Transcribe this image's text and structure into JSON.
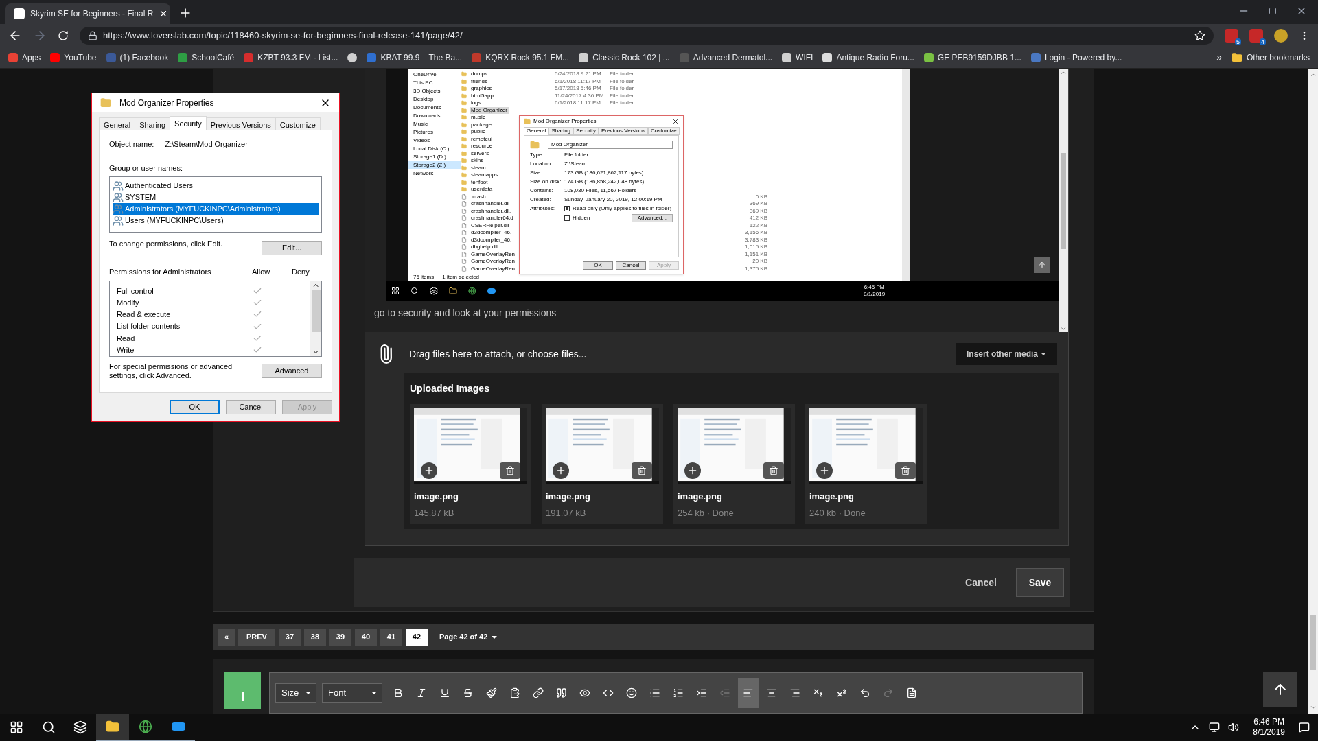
{
  "browser": {
    "tab_title": "Skyrim SE for Beginners - Final R",
    "url": "https://www.loverslab.com/topic/118460-skyrim-se-for-beginners-final-release-141/page/42/",
    "extension_badges": [
      "5",
      "4"
    ],
    "bookmarks": [
      {
        "label": "Apps",
        "color": "#e94235"
      },
      {
        "label": "YouTube",
        "color": "#ff0000"
      },
      {
        "label": "(1) Facebook",
        "color": "#3b5998"
      },
      {
        "label": "SchoolCafé",
        "color": "#2e9e44"
      },
      {
        "label": "KZBT 93.3 FM - List...",
        "color": "#d62d2d"
      },
      {
        "color": "#d0d0d0"
      },
      {
        "label": "KBAT 99.9 – The Ba...",
        "color": "#2f6fd0"
      },
      {
        "label": "KQRX Rock 95.1 FM...",
        "color": "#c0392b"
      },
      {
        "label": "Classic Rock 102 | ...",
        "color": "#d0d0d0"
      },
      {
        "label": "Advanced Dermatol...",
        "color": "#555555"
      },
      {
        "label": "WIFI",
        "color": "#d0d0d0"
      },
      {
        "label": "Antique Radio Foru...",
        "color": "#dddddd"
      },
      {
        "label": "GE PEB9159DJBB 1...",
        "color": "#7ac143"
      },
      {
        "label": "Login - Powered by...",
        "color": "#4a78c2"
      }
    ],
    "more": "»",
    "other_bookmarks": "Other bookmarks"
  },
  "post": {
    "embedded_screenshot": {
      "sidebar": [
        {
          "label": "OneDrive",
          "selected": false
        },
        {
          "label": "This PC",
          "selected": false
        },
        {
          "label": "3D Objects",
          "selected": false
        },
        {
          "label": "Desktop",
          "selected": false
        },
        {
          "label": "Documents",
          "selected": false
        },
        {
          "label": "Downloads",
          "selected": false
        },
        {
          "label": "Music",
          "selected": false
        },
        {
          "label": "Pictures",
          "selected": false
        },
        {
          "label": "Videos",
          "selected": false
        },
        {
          "label": "Local Disk (C:)",
          "selected": false
        },
        {
          "label": "Storage1 (D:)",
          "selected": false
        },
        {
          "label": "Storage2 (Z:)",
          "selected": true
        },
        {
          "label": "Network",
          "selected": false
        }
      ],
      "files": [
        {
          "kind": "folder",
          "name": "dumps",
          "date": "5/24/2018 9:21 PM",
          "type": "File folder",
          "selected": false
        },
        {
          "kind": "folder",
          "name": "friends",
          "date": "6/1/2018 11:17 PM",
          "type": "File folder",
          "selected": false
        },
        {
          "kind": "folder",
          "name": "graphics",
          "date": "5/17/2018 5:46 PM",
          "type": "File folder",
          "selected": false
        },
        {
          "kind": "folder",
          "name": "html5app",
          "date": "11/24/2017 4:36 PM",
          "type": "File folder",
          "selected": false
        },
        {
          "kind": "folder",
          "name": "logs",
          "date": "6/1/2018 11:17 PM",
          "type": "File folder",
          "selected": false
        },
        {
          "kind": "folder",
          "name": "Mod Organizer",
          "selected": true
        },
        {
          "kind": "folder",
          "name": "music",
          "selected": false
        },
        {
          "kind": "folder",
          "name": "package",
          "selected": false
        },
        {
          "kind": "folder",
          "name": "public",
          "selected": false
        },
        {
          "kind": "folder",
          "name": "remoteui",
          "selected": false
        },
        {
          "kind": "folder",
          "name": "resource",
          "selected": false
        },
        {
          "kind": "folder",
          "name": "servers",
          "selected": false
        },
        {
          "kind": "folder",
          "name": "skins",
          "selected": false
        },
        {
          "kind": "folder",
          "name": "steam",
          "selected": false
        },
        {
          "kind": "folder",
          "name": "steamapps",
          "selected": false
        },
        {
          "kind": "folder",
          "name": "tenfoot",
          "selected": false
        },
        {
          "kind": "folder",
          "name": "userdata",
          "selected": false
        },
        {
          "kind": "file",
          "name": ".crash",
          "size": "0 KB",
          "selected": false
        },
        {
          "kind": "file",
          "name": "crashhandler.dll",
          "size": "369 KB",
          "selected": false
        },
        {
          "kind": "file",
          "name": "crashhandler.dll.",
          "size": "369 KB",
          "selected": false
        },
        {
          "kind": "file",
          "name": "crashhandler64.d",
          "size": "412 KB",
          "selected": false
        },
        {
          "kind": "file",
          "name": "CSERHelper.dll",
          "size": "122 KB",
          "selected": false
        },
        {
          "kind": "file",
          "name": "d3dcompiler_46.",
          "size": "3,156 KB",
          "selected": false
        },
        {
          "kind": "file",
          "name": "d3dcompiler_46.",
          "size": "3,783 KB",
          "selected": false
        },
        {
          "kind": "file",
          "name": "dbghelp.dll",
          "size": "1,015 KB",
          "selected": false
        },
        {
          "kind": "file",
          "name": "GameOverlayRen",
          "size": "1,151 KB",
          "selected": false
        },
        {
          "kind": "file",
          "name": "GameOverlayRen",
          "size": "20 KB",
          "selected": false
        },
        {
          "kind": "file",
          "name": "GameOverlayRen",
          "size": "1,375 KB",
          "selected": false
        }
      ],
      "status": [
        "76 items",
        "1 item selected"
      ],
      "dialog": {
        "title": "Mod Organizer Properties",
        "tabs": [
          {
            "label": "General",
            "selected": true
          },
          {
            "label": "Sharing",
            "selected": false
          },
          {
            "label": "Security",
            "selected": false
          },
          {
            "label": "Previous Versions",
            "selected": false
          },
          {
            "label": "Customize",
            "selected": false
          }
        ],
        "name_value": "Mod Organizer",
        "rows": [
          {
            "label": "Type:",
            "value": "File folder"
          },
          {
            "label": "Location:",
            "value": "Z:\\Steam"
          },
          {
            "label": "Size:",
            "value": "173 GB (186,621,862,117 bytes)"
          },
          {
            "label": "Size on disk:",
            "value": "174 GB (186,858,242,048 bytes)"
          },
          {
            "label": "Contains:",
            "value": "108,030 Files, 11,567 Folders"
          },
          {
            "label": "Created:",
            "value": "Sunday, January 20, 2019, 12:00:19 PM"
          }
        ],
        "attributes_label": "Attributes:",
        "attributes": [
          {
            "label": "Read-only (Only applies to files in folder)",
            "checked": true
          },
          {
            "label": "Hidden",
            "checked": false
          }
        ],
        "advanced_button": "Advanced...",
        "buttons": [
          {
            "label": "OK",
            "disabled": false
          },
          {
            "label": "Cancel",
            "disabled": false
          },
          {
            "label": "Apply",
            "disabled": true
          }
        ]
      },
      "clock": [
        "6:45 PM",
        "8/1/2019"
      ]
    },
    "text": "go to security and look at your permissions"
  },
  "attach": {
    "hint": "Drag files here to attach, or choose files...",
    "insert_button": "Insert other media",
    "uploaded_title": "Uploaded Images",
    "images": [
      {
        "name": "image.png",
        "info": "145.87 kB"
      },
      {
        "name": "image.png",
        "info": "191.07 kB"
      },
      {
        "name": "image.png",
        "info": "254 kb · Done"
      },
      {
        "name": "image.png",
        "info": "240 kb · Done"
      }
    ]
  },
  "actions": {
    "cancel": "Cancel",
    "save": "Save"
  },
  "pagination": {
    "first": "«",
    "prev": "PREV",
    "pages": [
      {
        "label": "37",
        "selected": false
      },
      {
        "label": "38",
        "selected": false
      },
      {
        "label": "39",
        "selected": false
      },
      {
        "label": "40",
        "selected": false
      },
      {
        "label": "41",
        "selected": false
      },
      {
        "label": "42",
        "selected": true
      }
    ],
    "summary": "Page 42 of 42"
  },
  "editor": {
    "dropdowns": [
      "Size",
      "Font"
    ],
    "buttons": [
      {
        "kind": "bold",
        "selected": false,
        "disabled": false
      },
      {
        "kind": "italic",
        "selected": false,
        "disabled": false
      },
      {
        "kind": "underline",
        "selected": false,
        "disabled": false
      },
      {
        "kind": "strike",
        "selected": false,
        "disabled": false
      },
      {
        "kind": "brush",
        "selected": false,
        "disabled": false
      },
      {
        "kind": "paste",
        "selected": false,
        "disabled": false
      },
      {
        "kind": "link",
        "selected": false,
        "disabled": false
      },
      {
        "kind": "quote",
        "selected": false,
        "disabled": false
      },
      {
        "kind": "spoiler",
        "selected": false,
        "disabled": false
      },
      {
        "kind": "code",
        "selected": false,
        "disabled": false
      },
      {
        "kind": "emoji",
        "selected": false,
        "disabled": false
      },
      {
        "kind": "bullets",
        "selected": false,
        "disabled": false
      },
      {
        "kind": "numbers",
        "selected": false,
        "disabled": false
      },
      {
        "kind": "indent",
        "selected": false,
        "disabled": false
      },
      {
        "kind": "outdent",
        "selected": false,
        "disabled": true
      },
      {
        "kind": "left",
        "selected": true,
        "disabled": false
      },
      {
        "kind": "center",
        "selected": false,
        "disabled": false
      },
      {
        "kind": "right",
        "selected": false,
        "disabled": false
      },
      {
        "kind": "sub",
        "selected": false,
        "disabled": false
      },
      {
        "kind": "sup",
        "selected": false,
        "disabled": false
      },
      {
        "kind": "undo",
        "selected": false,
        "disabled": false
      },
      {
        "kind": "redo",
        "selected": false,
        "disabled": true
      },
      {
        "kind": "source",
        "selected": false,
        "disabled": false
      }
    ]
  },
  "dialog": {
    "title": "Mod Organizer Properties",
    "tabs": [
      {
        "label": "General",
        "selected": false
      },
      {
        "label": "Sharing",
        "selected": false
      },
      {
        "label": "Security",
        "selected": true
      },
      {
        "label": "Previous Versions",
        "selected": false
      },
      {
        "label": "Customize",
        "selected": false
      }
    ],
    "object_label": "Object name:",
    "object_value": "Z:\\Steam\\Mod Organizer",
    "group_label": "Group or user names:",
    "users": [
      {
        "name": "Authenticated Users",
        "selected": false
      },
      {
        "name": "SYSTEM",
        "selected": false
      },
      {
        "name": "Administrators (MYFUCKINPC\\Administrators)",
        "selected": true
      },
      {
        "name": "Users (MYFUCKINPC\\Users)",
        "selected": false
      }
    ],
    "change_hint": "To change permissions, click Edit.",
    "edit_button": "Edit...",
    "permissions_label": "Permissions for Administrators",
    "allow_header": "Allow",
    "deny_header": "Deny",
    "permissions": [
      {
        "name": "Full control",
        "allow": true
      },
      {
        "name": "Modify",
        "allow": true
      },
      {
        "name": "Read & execute",
        "allow": true
      },
      {
        "name": "List folder contents",
        "allow": true
      },
      {
        "name": "Read",
        "allow": true
      },
      {
        "name": "Write",
        "allow": true
      }
    ],
    "advanced_hint": "For special permissions or advanced settings, click Advanced.",
    "advanced_button": "Advanced",
    "buttons": [
      {
        "label": "OK",
        "disabled": false,
        "selected": true
      },
      {
        "label": "Cancel",
        "disabled": false,
        "selected": false
      },
      {
        "label": "Apply",
        "disabled": true,
        "selected": false
      }
    ]
  },
  "taskbar": {
    "apps": [
      {
        "kind": "explorer",
        "selected": true
      },
      {
        "kind": "chrome",
        "selected": false
      },
      {
        "kind": "app",
        "selected": false
      }
    ],
    "clock": [
      "6:46 PM",
      "8/1/2019"
    ]
  }
}
